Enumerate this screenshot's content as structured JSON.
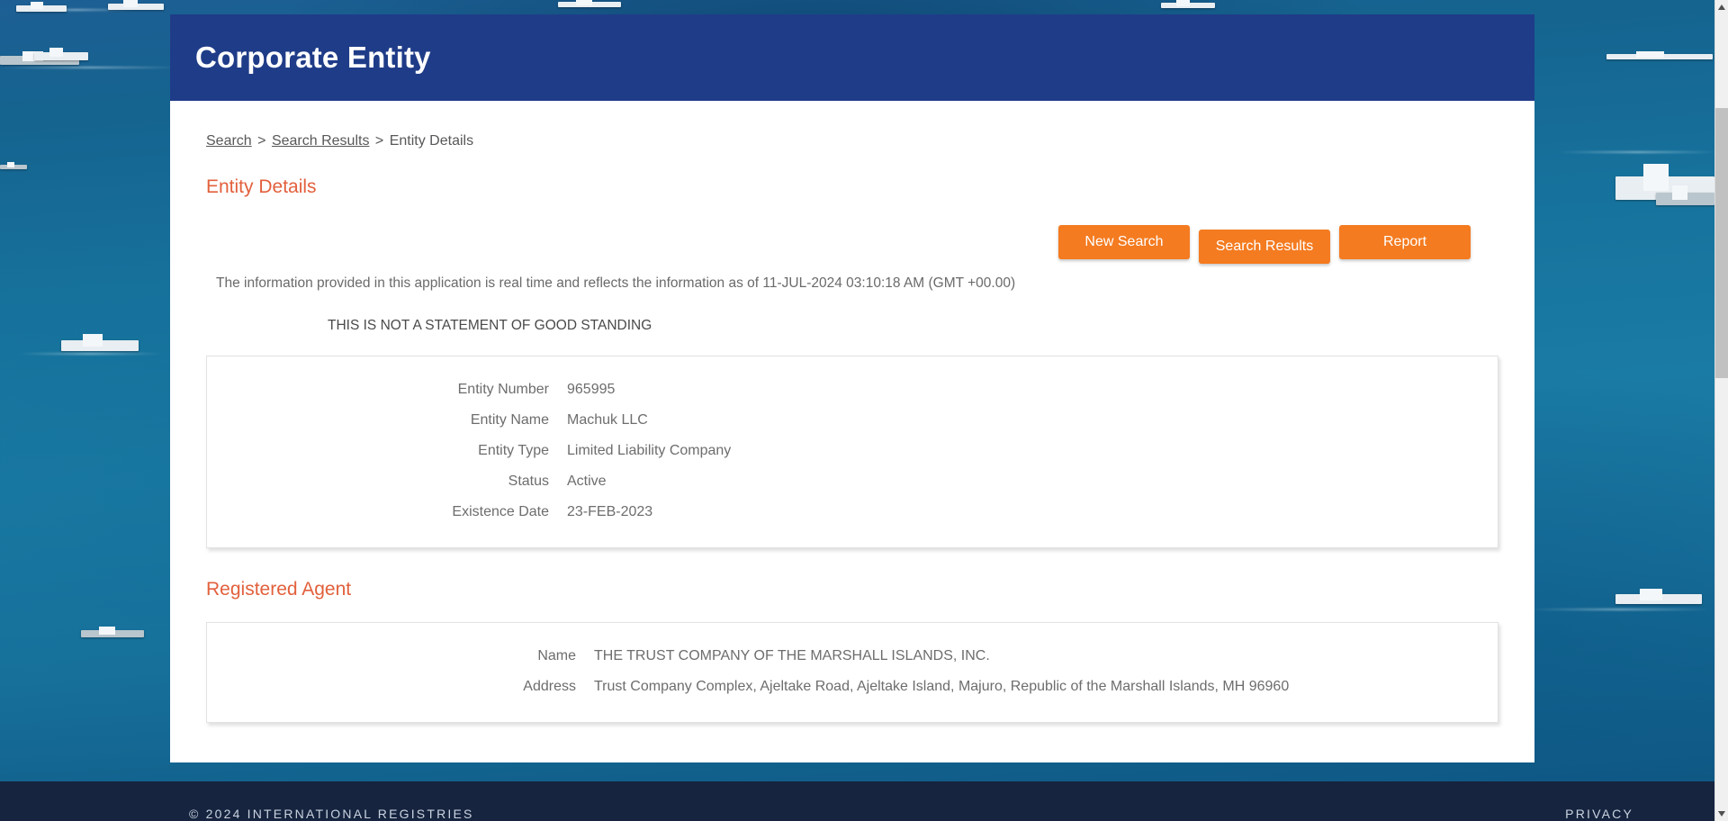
{
  "site": {
    "title": "Corporate Entity",
    "header_bg": "#1f3c88",
    "accent": "#e2603c",
    "button_bg": "#f47b20"
  },
  "breadcrumb": {
    "items": [
      {
        "label": "Search",
        "link": true
      },
      {
        "label": "Search Results",
        "link": true
      },
      {
        "label": "Entity Details",
        "link": false
      }
    ],
    "separator": ">"
  },
  "sections": {
    "entity_details_heading": "Entity Details",
    "registered_agent_heading": "Registered Agent"
  },
  "toolbar": {
    "new_search_label": "New Search",
    "search_results_label": "Search Results",
    "report_label": "Report"
  },
  "notices": {
    "realtime": "The information provided in this application is real time and reflects the information as of 11-JUL-2024 03:10:18 AM (GMT +00.00)",
    "good_standing": "THIS IS NOT A STATEMENT OF GOOD STANDING"
  },
  "entity_details": [
    {
      "label": "Entity Number",
      "value": "965995"
    },
    {
      "label": "Entity Name",
      "value": "Machuk LLC"
    },
    {
      "label": "Entity Type",
      "value": "Limited Liability Company"
    },
    {
      "label": "Status",
      "value": "Active"
    },
    {
      "label": "Existence Date",
      "value": "23-FEB-2023"
    }
  ],
  "registered_agent": [
    {
      "label": "Name",
      "value": "THE TRUST COMPANY OF THE MARSHALL ISLANDS, INC."
    },
    {
      "label": "Address",
      "value": "Trust Company Complex, Ajeltake Road, Ajeltake Island, Majuro, Republic of the Marshall Islands, MH 96960"
    }
  ],
  "footer": {
    "copyright": "© 2024 INTERNATIONAL REGISTRIES",
    "privacy_label": "PRIVACY"
  }
}
